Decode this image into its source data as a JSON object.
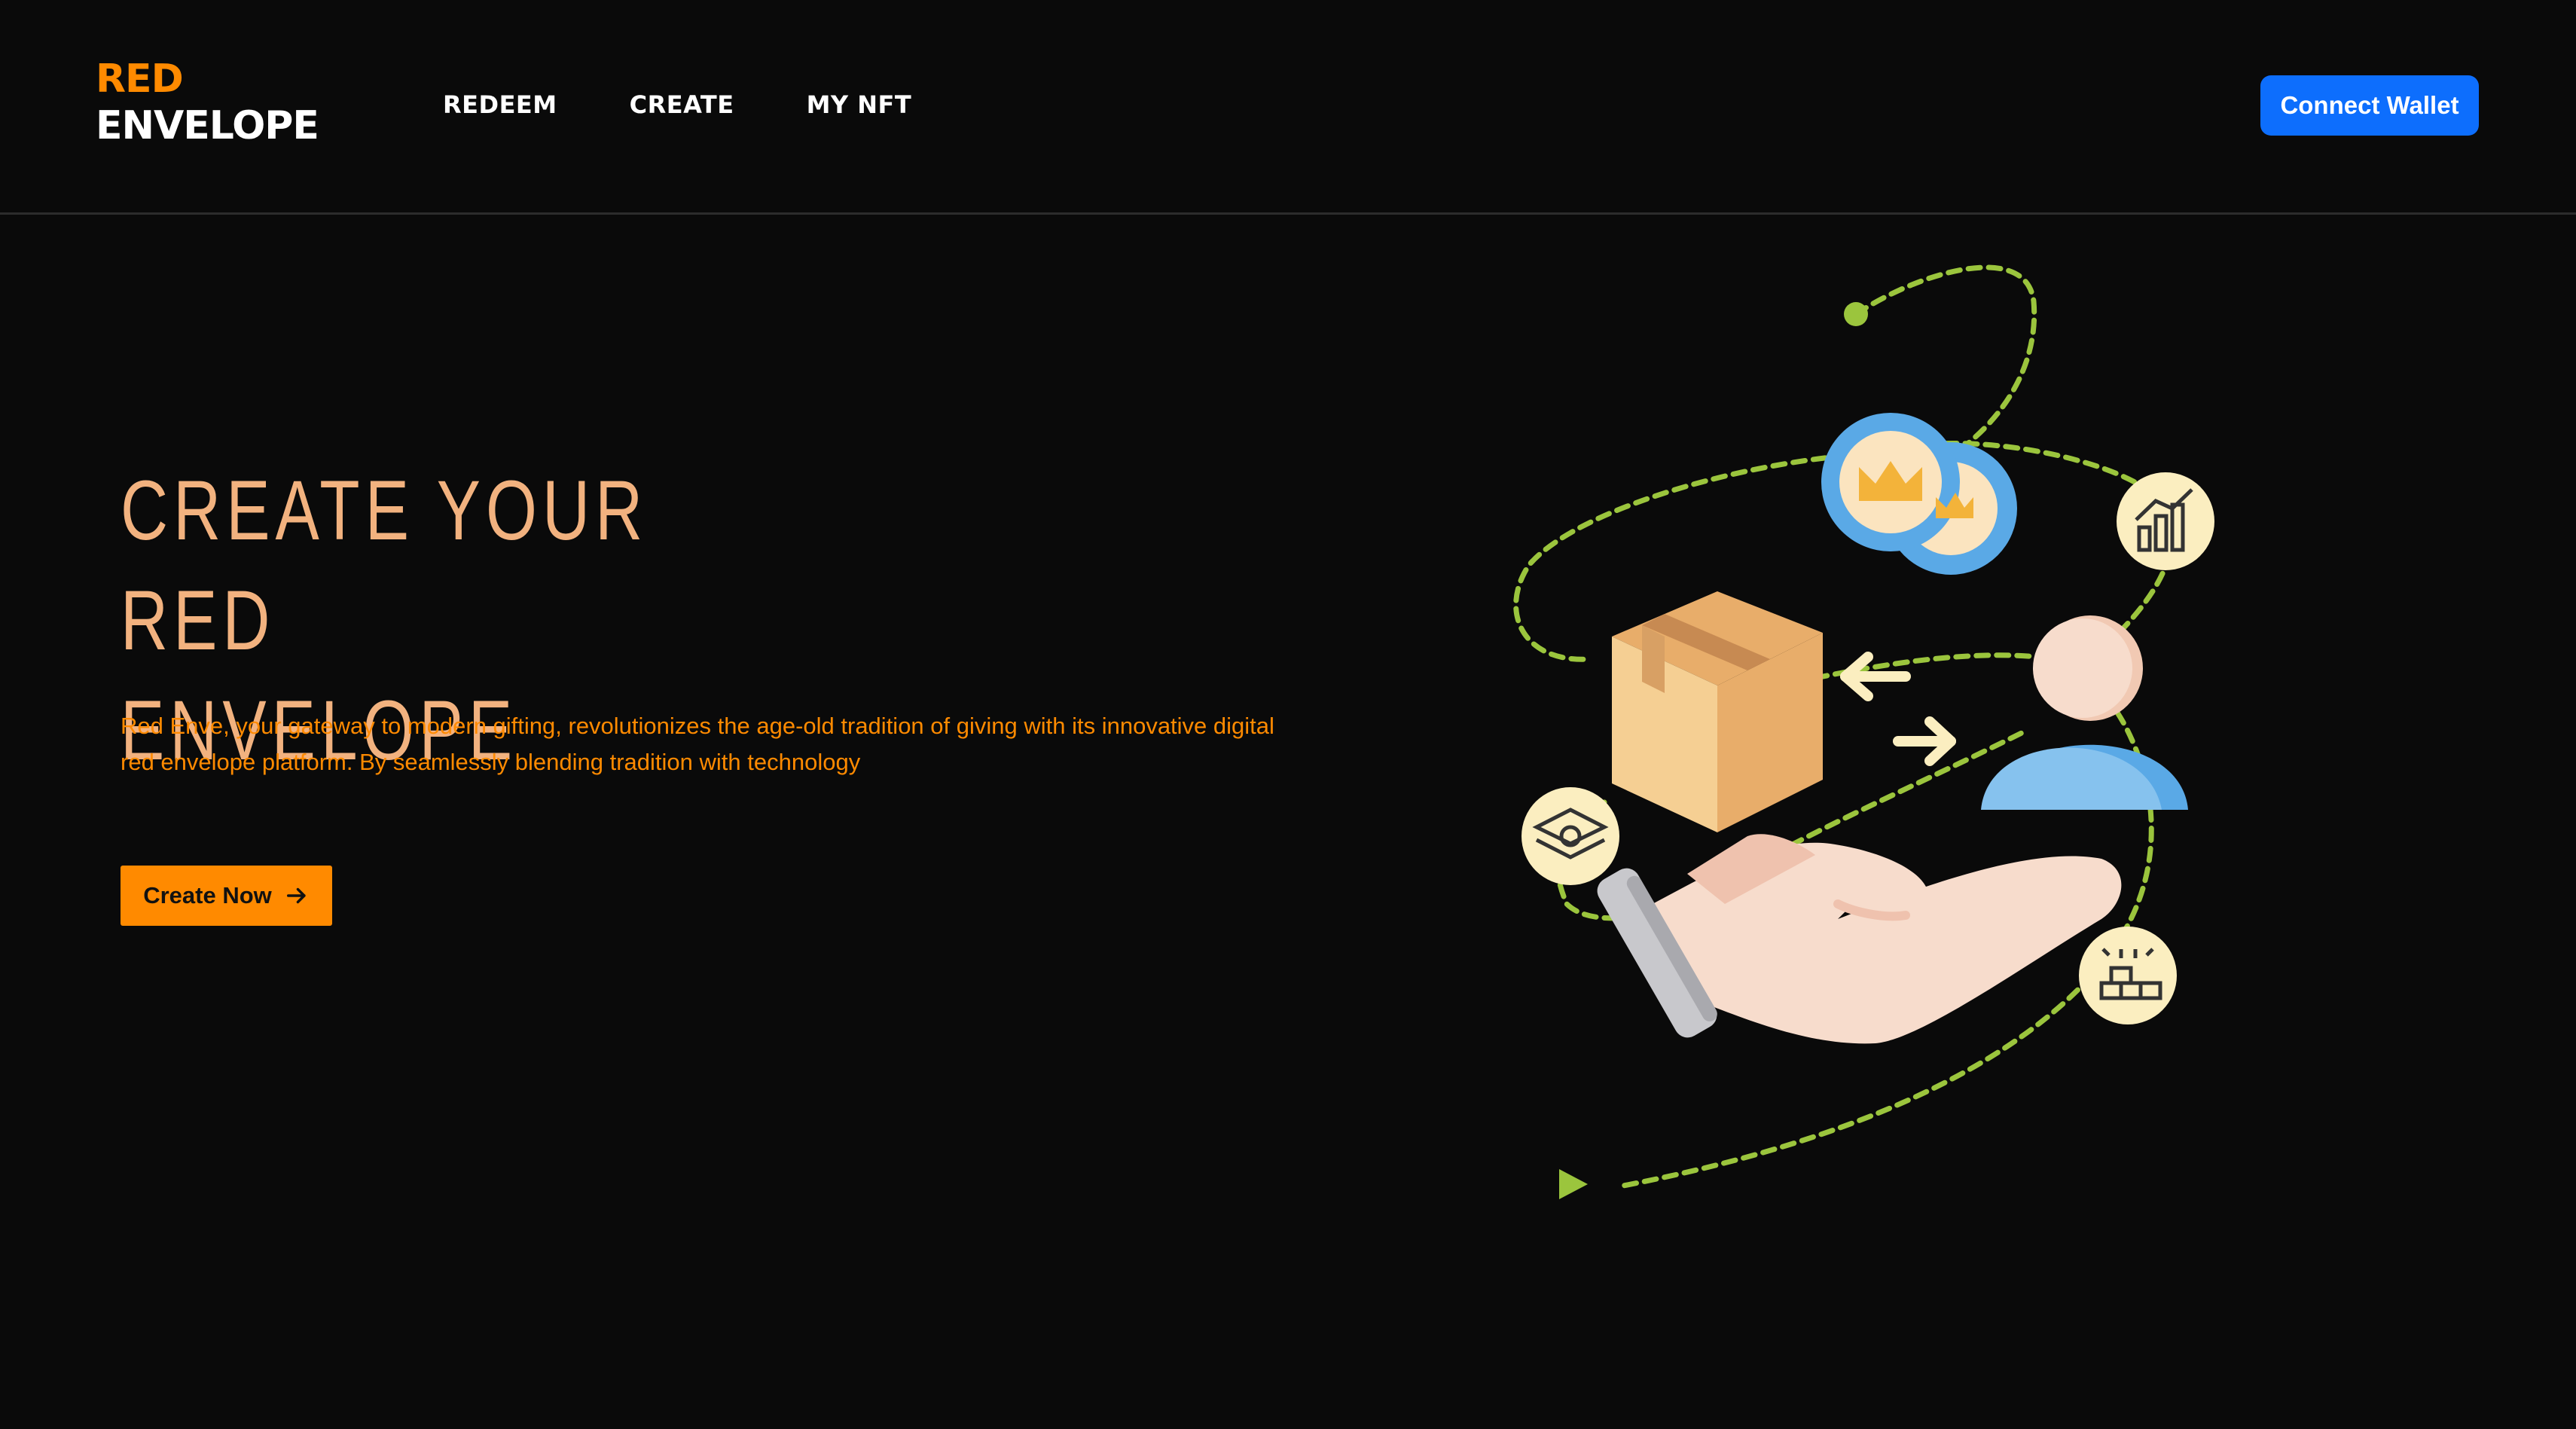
{
  "header": {
    "logo_line1": "RED",
    "logo_line2": "ENVELOPE",
    "nav": [
      "REDEEM",
      "CREATE",
      "MY NFT"
    ],
    "connect_label": "Connect Wallet"
  },
  "hero": {
    "title_line1": "CREATE YOUR RED",
    "title_line2": "ENVELOPE",
    "description": "Red Enve, your gateway to modern gifting, revolutionizes the age-old tradition of giving with its innovative digital red envelope platform. By seamlessly blending tradition with technology",
    "cta_label": "Create Now"
  },
  "icons": {
    "cta_icon": "arrow-right-icon"
  },
  "colors": {
    "background": "#0a0a0a",
    "accent_orange": "#ff8a00",
    "title_peach": "#f2b27f",
    "connect_blue": "#0d6efd",
    "dash_green": "#9bc53d"
  }
}
